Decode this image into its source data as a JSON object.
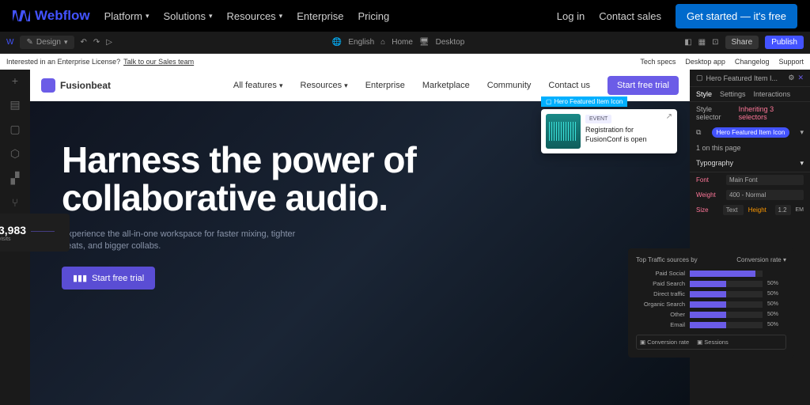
{
  "topnav": {
    "brand": "Webflow",
    "items": [
      "Platform",
      "Solutions",
      "Resources"
    ],
    "enterprise": "Enterprise",
    "pricing": "Pricing",
    "login": "Log in",
    "contact": "Contact sales",
    "cta": "Get started — it's free"
  },
  "designer": {
    "mode": "Design",
    "lang": "English",
    "home": "Home",
    "desktop": "Desktop",
    "share": "Share",
    "publish": "Publish"
  },
  "entbar": {
    "lead": "Interested in an Enterprise License?",
    "link": "Talk to our Sales team"
  },
  "entlinks": [
    "Tech specs",
    "Desktop app",
    "Changelog",
    "Support"
  ],
  "site": {
    "name": "Fusionbeat",
    "nav": [
      "All features",
      "Resources",
      "Enterprise",
      "Marketplace",
      "Community",
      "Contact us"
    ],
    "cta": "Start free trial"
  },
  "hero": {
    "h1a": "Harness the power of",
    "h1b": "collaborative audio.",
    "sub": "Experience the all-in-one workspace for faster mixing, tighter beats, and bigger collabs.",
    "btn": "Start free trial"
  },
  "popup": {
    "tag": "Hero Featured Item Icon",
    "badge": "EVENT",
    "line1": "Registration for",
    "line2": "FusionConf is open"
  },
  "panel": {
    "crumb": "Hero Featured Item I...",
    "tabs": [
      "Style",
      "Settings",
      "Interactions"
    ],
    "selector_lbl": "Style selector",
    "inheriting": "Inheriting",
    "inh_count": "3 selectors",
    "tag": "Hero Featured Item Icon",
    "onpage": "1 on this page",
    "section": "Typography",
    "font_lbl": "Font",
    "font_val": "Main Font",
    "weight_lbl": "Weight",
    "weight_val": "400 - Normal",
    "size_lbl": "Size",
    "size_text": "Text",
    "height_lbl": "Height",
    "height_val": "1.2",
    "unit": "EM"
  },
  "analytics": {
    "title": "Top Traffic sources by",
    "metric": "Conversion rate",
    "legend1": "Conversion rate",
    "legend2": "Sessions",
    "rows": [
      {
        "src": "Paid Social",
        "pct": 90,
        "pct_label": ""
      },
      {
        "src": "Paid Search",
        "pct": 50,
        "pct_label": "50%"
      },
      {
        "src": "Direct traffic",
        "pct": 50,
        "pct_label": "50%"
      },
      {
        "src": "Organic Search",
        "pct": 50,
        "pct_label": "50%"
      },
      {
        "src": "Other",
        "pct": 50,
        "pct_label": "50%"
      },
      {
        "src": "Email",
        "pct": 50,
        "pct_label": "50%"
      }
    ]
  },
  "stat": {
    "value": "3,983",
    "label": "visits"
  }
}
